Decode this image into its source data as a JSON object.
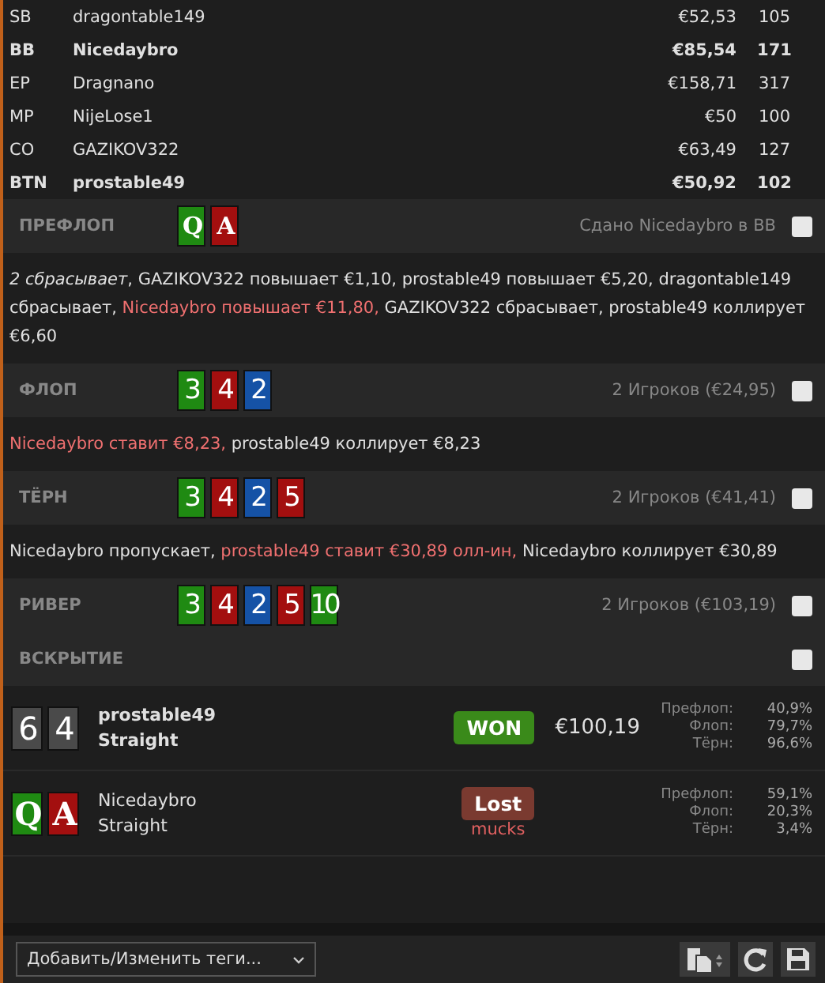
{
  "players": [
    {
      "position": "SB",
      "name": "dragontable149",
      "stack": "€52,53",
      "bb": "105",
      "highlighted": false
    },
    {
      "position": "BB",
      "name": "Nicedaybro",
      "stack": "€85,54",
      "bb": "171",
      "highlighted": true
    },
    {
      "position": "EP",
      "name": "Dragnano",
      "stack": "€158,71",
      "bb": "317",
      "highlighted": false
    },
    {
      "position": "MP",
      "name": "NijeLose1",
      "stack": "€50",
      "bb": "100",
      "highlighted": false
    },
    {
      "position": "CO",
      "name": "GAZIKOV322",
      "stack": "€63,49",
      "bb": "127",
      "highlighted": false
    },
    {
      "position": "BTN",
      "name": "prostable49",
      "stack": "€50,92",
      "bb": "102",
      "highlighted": true
    }
  ],
  "streets": [
    {
      "name": "ПРЕФЛОП",
      "cards": [
        {
          "rank": "Q",
          "color": "#1f8a12"
        },
        {
          "rank": "A",
          "color": "#a30f0f"
        }
      ],
      "info": "Сдано Nicedaybro в BB",
      "checked": false,
      "actions": [
        {
          "text": "*2 сбрасывает*, GAZIKOV322 повышает €1,10, prostable49 повышает €5,20, dragontable149 сбрасывает, ",
          "highlighted": false
        },
        {
          "text": "Nicedaybro повышает €11,80,",
          "highlighted": true
        },
        {
          "text": " GAZIKOV322 сбрасывает, prostable49 коллирует €6,60",
          "highlighted": false
        }
      ]
    },
    {
      "name": "ФЛОП",
      "cards": [
        {
          "rank": "3",
          "color": "#1f8a12"
        },
        {
          "rank": "4",
          "color": "#a30f0f"
        },
        {
          "rank": "2",
          "color": "#1552a6"
        }
      ],
      "info": "2 Игроков (€24,95)",
      "checked": false,
      "actions": [
        {
          "text": "Nicedaybro ставит €8,23,",
          "highlighted": true
        },
        {
          "text": " prostable49 коллирует €8,23",
          "highlighted": false
        }
      ]
    },
    {
      "name": "ТЁРН",
      "cards": [
        {
          "rank": "3",
          "color": "#1f8a12"
        },
        {
          "rank": "4",
          "color": "#a30f0f"
        },
        {
          "rank": "2",
          "color": "#1552a6"
        },
        {
          "rank": "5",
          "color": "#a30f0f"
        }
      ],
      "info": "2 Игроков (€41,41)",
      "checked": false,
      "actions": [
        {
          "text": "Nicedaybro пропускает, ",
          "highlighted": false
        },
        {
          "text": "prostable49 ставит €30,89 олл-ин,",
          "highlighted": true
        },
        {
          "text": " Nicedaybro коллирует €30,89",
          "highlighted": false
        }
      ]
    },
    {
      "name": "РИВЕР",
      "cards": [
        {
          "rank": "3",
          "color": "#1f8a12"
        },
        {
          "rank": "4",
          "color": "#a30f0f"
        },
        {
          "rank": "2",
          "color": "#1552a6"
        },
        {
          "rank": "5",
          "color": "#a30f0f"
        },
        {
          "rank": "10",
          "color": "#1f8a12"
        }
      ],
      "info": "2 Игроков (€103,19)",
      "checked": false
    }
  ],
  "showdown": {
    "title": "ВСКРЫТИЕ",
    "checked": false,
    "hands": [
      {
        "cards": [
          {
            "rank": "6",
            "color": "#4a4a4a"
          },
          {
            "rank": "4",
            "color": "#4a4a4a"
          }
        ],
        "name": "prostable49",
        "hand": "Straight",
        "won": true,
        "result_label": "WON",
        "amount": "€100,19",
        "equities": [
          {
            "street": "Префлоп:",
            "value": "40,9%"
          },
          {
            "street": "Флоп:",
            "value": "79,7%"
          },
          {
            "street": "Тёрн:",
            "value": "96,6%"
          }
        ]
      },
      {
        "cards": [
          {
            "rank": "Q",
            "color": "#1f8a12"
          },
          {
            "rank": "A",
            "color": "#a30f0f"
          }
        ],
        "name": "Nicedaybro",
        "hand": "Straight",
        "won": false,
        "result_label": "Lost",
        "note": "mucks",
        "equities": [
          {
            "street": "Префлоп:",
            "value": "59,1%"
          },
          {
            "street": "Флоп:",
            "value": "20,3%"
          },
          {
            "street": "Тёрн:",
            "value": "3,4%"
          }
        ]
      }
    ]
  },
  "tags": {
    "placeholder": "Добавить/Изменить теги..."
  }
}
